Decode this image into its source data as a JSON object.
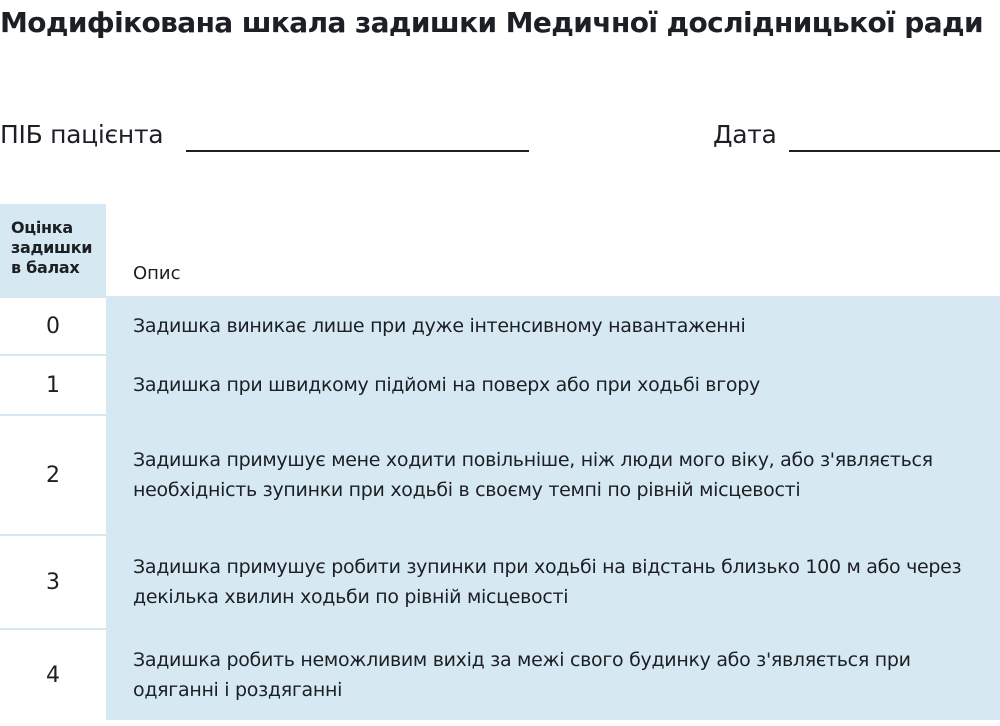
{
  "title": "Модифікована шкала задишки Медичної дослідницької ради",
  "patient_field": {
    "label": "ПІБ пацієнта"
  },
  "date_field": {
    "label": "Дата"
  },
  "table": {
    "header_score_lines": [
      "Оцінка",
      "задишки",
      "в балах"
    ],
    "header_description": "Опис",
    "rows": [
      {
        "score": "0",
        "description": "Задишка виникає лише при дуже інтенсивному навантаженні"
      },
      {
        "score": "1",
        "description": "Задишка при швидкому підйомі на поверх або при ходьбі вгору"
      },
      {
        "score": "2",
        "description": "Задишка примушує мене ходити повільніше, ніж люди мого віку, або з'являється необхідність зупинки при ходьбі в своєму темпі по рівній місцевості"
      },
      {
        "score": "3",
        "description": "Задишка примушує робити зупинки при ходьбі на відстань близько 100 м або через декілька хвилин ходьби по рівній місцевості"
      },
      {
        "score": "4",
        "description": "Задишка робить неможливим вихід за межі свого будинку або з'являється при одяганні і роздяганні"
      }
    ]
  },
  "colors": {
    "cell_fill": "#d6e9f2",
    "text": "#1c1f24"
  }
}
